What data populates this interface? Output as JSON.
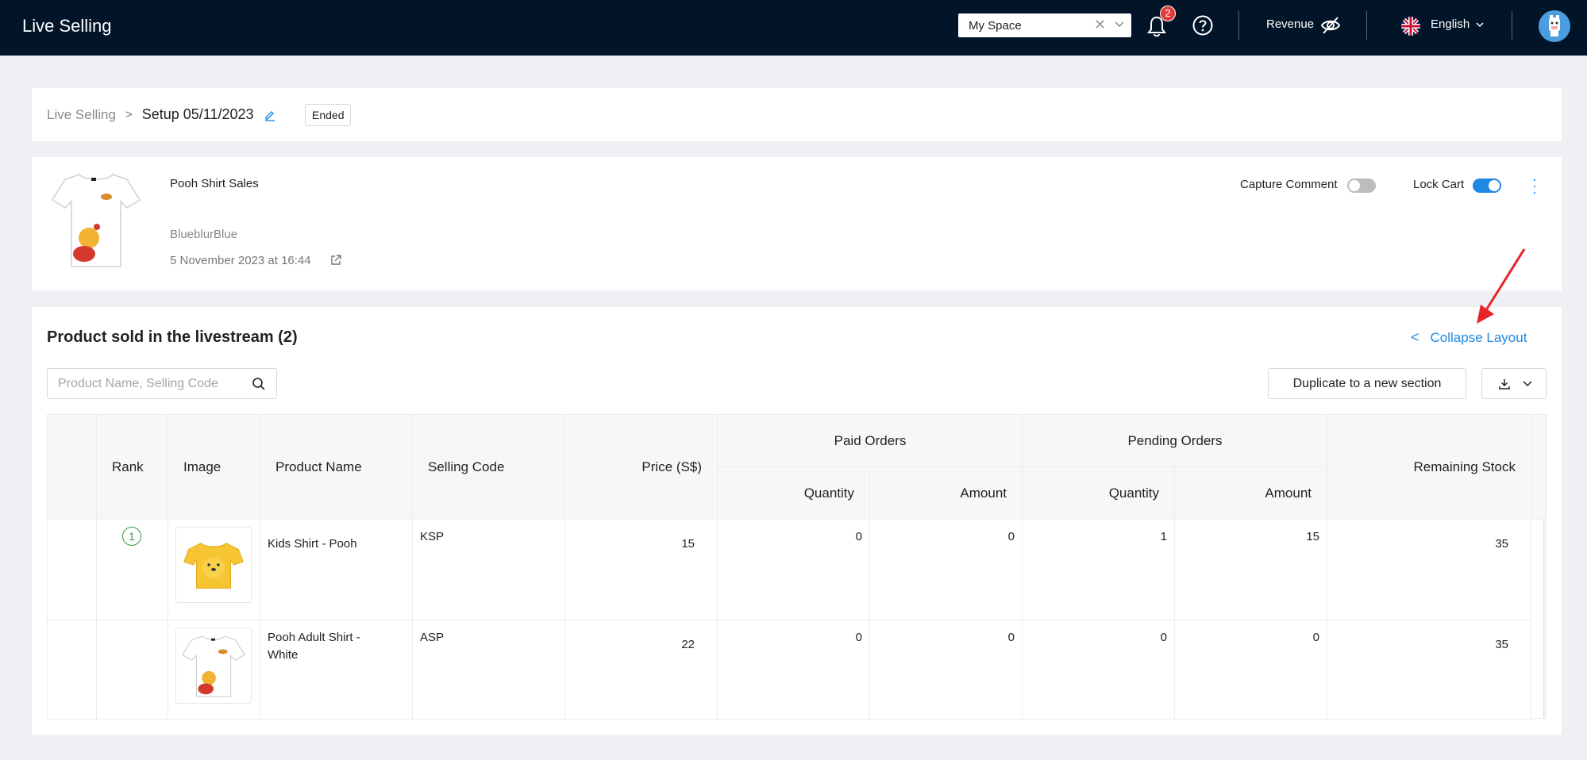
{
  "header": {
    "app_title": "Live Selling",
    "space_select_value": "My Space",
    "notification_count": "2",
    "revenue_label": "Revenue",
    "language_label": "English"
  },
  "breadcrumb": {
    "root": "Live Selling",
    "separator": ">",
    "current": "Setup 05/11/2023",
    "status": "Ended"
  },
  "livestream": {
    "name": "Pooh Shirt Sales",
    "page_name": "BlueblurBlue",
    "date": "5 November 2023 at 16:44",
    "capture_comment_label": "Capture Comment",
    "capture_comment_on": false,
    "lock_cart_label": "Lock Cart",
    "lock_cart_on": true
  },
  "products": {
    "title": "Product sold in the livestream (2)",
    "collapse_label": "Collapse Layout",
    "search_placeholder": "Product Name, Selling Code",
    "duplicate_label": "Duplicate to a new section",
    "columns": {
      "rank": "Rank",
      "image": "Image",
      "product_name": "Product Name",
      "selling_code": "Selling Code",
      "price": "Price (S$)",
      "paid_orders": "Paid Orders",
      "pending_orders": "Pending Orders",
      "quantity": "Quantity",
      "amount": "Amount",
      "remaining_stock": "Remaining Stock"
    },
    "rows": [
      {
        "rank": "1",
        "product_name": "Kids Shirt - Pooh",
        "selling_code": "KSP",
        "price": "15",
        "paid_qty": "0",
        "paid_amount": "0",
        "pending_qty": "1",
        "pending_amount": "15",
        "remaining": "35",
        "image": "yellow-pooh-shirt"
      },
      {
        "rank": "",
        "product_name": "Pooh Adult Shirt - White",
        "selling_code": "ASP",
        "price": "22",
        "paid_qty": "0",
        "paid_amount": "0",
        "pending_qty": "0",
        "pending_amount": "0",
        "remaining": "35",
        "image": "white-pooh-shirt"
      }
    ]
  },
  "colors": {
    "topbar": "#021428",
    "accent": "#1e88e5",
    "badge": "#e33b3b",
    "rank_badge": "#2e9a3f",
    "annotation_arrow": "#e8242b"
  }
}
